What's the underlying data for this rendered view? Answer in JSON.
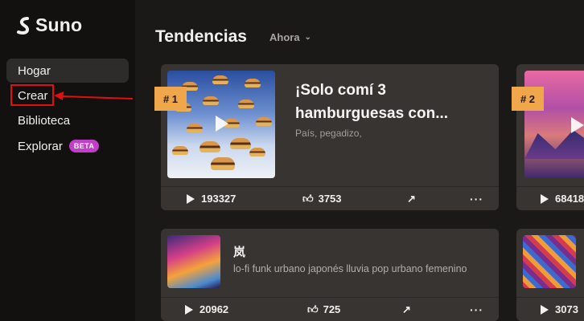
{
  "app": {
    "name": "Suno"
  },
  "sidebar": {
    "items": [
      {
        "label": "Hogar"
      },
      {
        "label": "Crear"
      },
      {
        "label": "Biblioteca"
      },
      {
        "label": "Explorar",
        "badge": "BETA"
      }
    ]
  },
  "main": {
    "section_title": "Tendencias",
    "filter": {
      "selected": "Ahora"
    },
    "cards": [
      {
        "rank": "# 1",
        "title": "¡Solo comí 3 hamburguesas con...",
        "tags": "País, pegadizo,",
        "plays": "193327",
        "likes": "3753"
      },
      {
        "rank": "# 2",
        "plays": "68418"
      },
      {
        "title": "岚",
        "description": "lo-fi funk urbano japonés lluvia pop urbano femenino",
        "plays": "20962",
        "likes": "725"
      },
      {
        "plays": "3073"
      }
    ]
  },
  "colors": {
    "accent_rank": "#f0a64a",
    "beta_badge": "#c23ec9",
    "annotation_red": "#e01010"
  },
  "icons": [
    "suno-logo-icon",
    "chevron-down-icon",
    "play-icon",
    "thumbs-up-icon",
    "share-icon",
    "more-icon"
  ]
}
